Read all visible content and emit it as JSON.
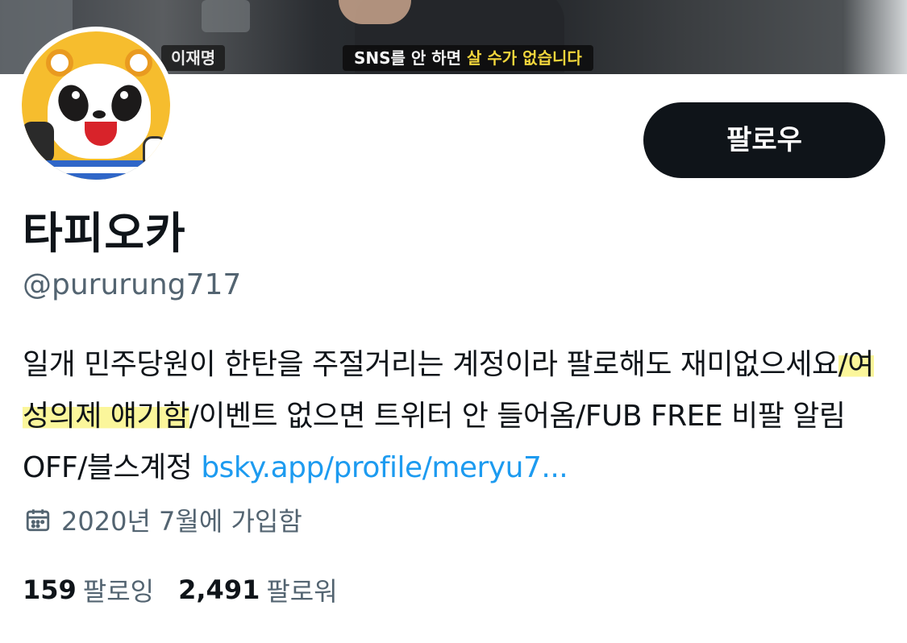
{
  "banner": {
    "name_tag": "이재명",
    "caption_prefix": "SNS를 안 하면 ",
    "caption_highlight": "살 수가 없습니다"
  },
  "profile": {
    "display_name": "타피오카",
    "handle": "@pururung717",
    "follow_label": "팔로우"
  },
  "bio": {
    "text_before": "일개 민주당원이 한탄을 주절거리는 계정이라 팔로해도 재미없으세요",
    "highlighted": "/여성의제 얘기함",
    "text_after": "/이벤트 없으면 트위터 안 들어옴/FUB FREE 비팔 알림 OFF/블스계정 ",
    "link": "bsky.app/profile/meryu7..."
  },
  "joined": {
    "icon": "calendar-icon",
    "text": "2020년 7월에 가입함"
  },
  "stats": {
    "following_count": "159",
    "following_label": "팔로잉",
    "followers_count": "2,491",
    "followers_label": "팔로워"
  },
  "colors": {
    "text": "#0f1419",
    "secondary": "#536471",
    "link": "#1d9bf0",
    "button_bg": "#0f1419",
    "highlight": "#fbf69b"
  }
}
